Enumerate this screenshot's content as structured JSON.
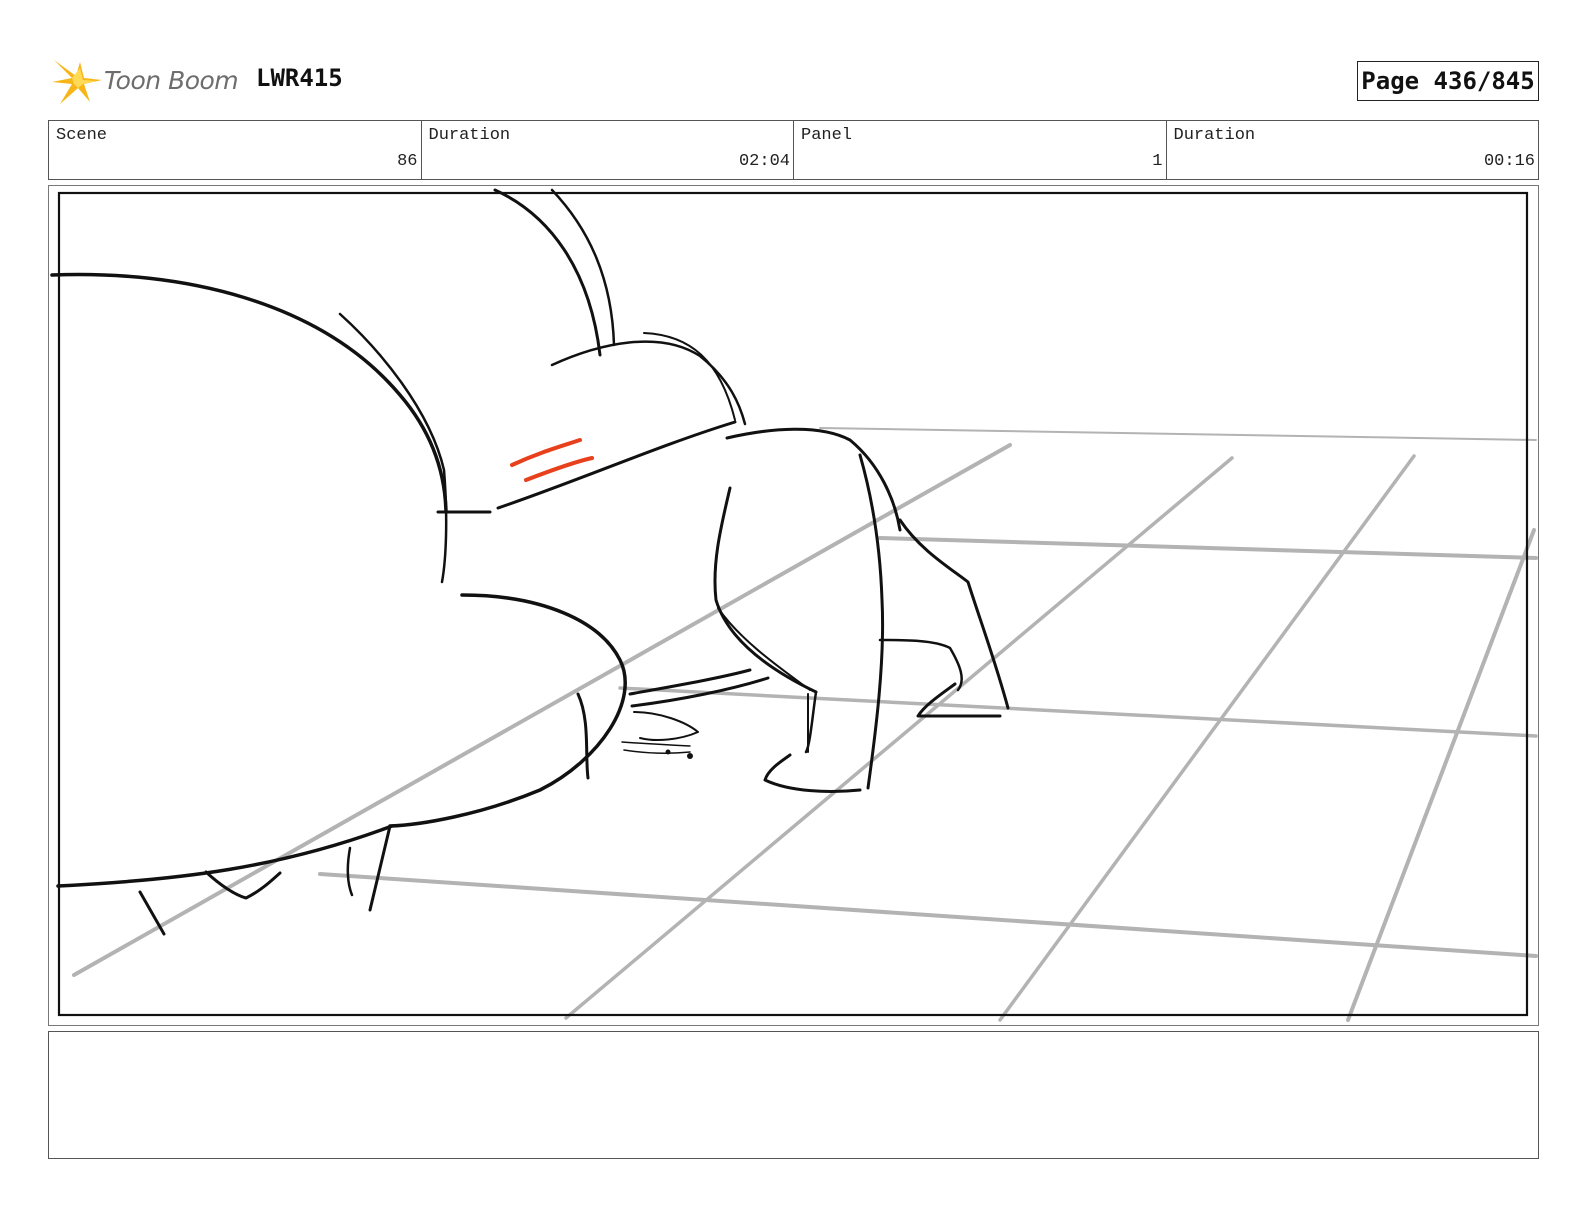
{
  "header": {
    "brand": "Toon Boom",
    "project_code": "LWR415",
    "page": "Page 436/845"
  },
  "info": {
    "scene_label": "Scene",
    "scene_value": "86",
    "scene_duration_label": "Duration",
    "scene_duration_value": "02:04",
    "panel_label": "Panel",
    "panel_value": "1",
    "panel_duration_label": "Duration",
    "panel_duration_value": "00:16"
  },
  "notes": {
    "text": ""
  },
  "colors": {
    "sketch": "#111111",
    "guide": "#b3b3b3",
    "accent": "#e8401c",
    "logo_star": "#f7b517"
  }
}
